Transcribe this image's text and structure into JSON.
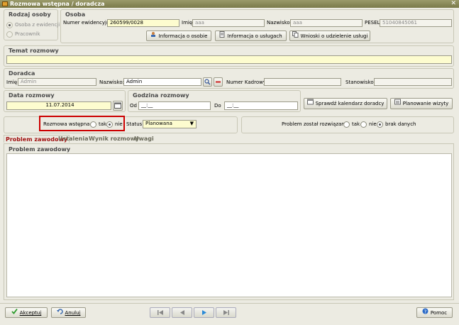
{
  "window": {
    "title": "Rozmowa wstępna / doradcza"
  },
  "rodzaj": {
    "title": "Rodzaj osoby",
    "options": [
      "Osoba z ewidencji",
      "Pracownik"
    ],
    "selected": 0
  },
  "osoba": {
    "title": "Osoba",
    "nr_label": "Numer ewidencyjny",
    "nr_value": "260599/0028",
    "imie_label": "Imię",
    "imie_value": "aaa",
    "nazwisko_label": "Nazwisko",
    "nazwisko_value": "aaa",
    "pesel_label": "PESEL",
    "pesel_value": "51040845061",
    "btn_info_osobie": "Informacja o osobie",
    "btn_info_uslugach": "Informacja o usługach",
    "btn_wnioski": "Wnioski o udzielenie usługi"
  },
  "temat": {
    "title": "Temat rozmowy",
    "value": ""
  },
  "doradca": {
    "title": "Doradca",
    "imie_label": "Imię:",
    "imie_value": "Admin",
    "nazwisko_label": "Nazwisko:",
    "nazwisko_value": "Admin",
    "nr_kadrowy_label": "Numer Kadrowy:",
    "nr_kadrowy_value": "",
    "stanowisko_label": "Stanowisko:",
    "stanowisko_value": ""
  },
  "data_rozmowy": {
    "title": "Data rozmowy",
    "value": "11.07.2014"
  },
  "godzina": {
    "title": "Godzina rozmowy",
    "od_label": "Od",
    "od_value": "__:__",
    "do_label": "Do",
    "do_value": "__:__"
  },
  "btn_kalendarz": "Sprawdź kalendarz doradcy",
  "btn_planowanie": "Planowanie wizyty",
  "rozmowa_wstepna": {
    "label": "Rozmowa wstępna:",
    "tak": "tak",
    "nie": "nie",
    "selected": "nie"
  },
  "status": {
    "label": "Status:",
    "value": "Planowana"
  },
  "problem_rozwiazany": {
    "label": "Problem został rozwiązany:",
    "tak": "tak",
    "nie": "nie",
    "brak": "brak danych",
    "selected": "brak danych"
  },
  "tabs": [
    "Problem zawodowy",
    "Ustalenia",
    "Wynik rozmowy",
    "Uwagi"
  ],
  "active_tab": 0,
  "problem_zawodowy": {
    "title": "Problem zawodowy",
    "value": ""
  },
  "footer": {
    "akceptuj": "Akceptuj",
    "anuluj": "Anuluj",
    "pomoc": "Pomoc"
  },
  "colors": {
    "highlight": "#cc0000",
    "title_bar": "#8a8a5a",
    "required_field": "#fdfccf"
  }
}
